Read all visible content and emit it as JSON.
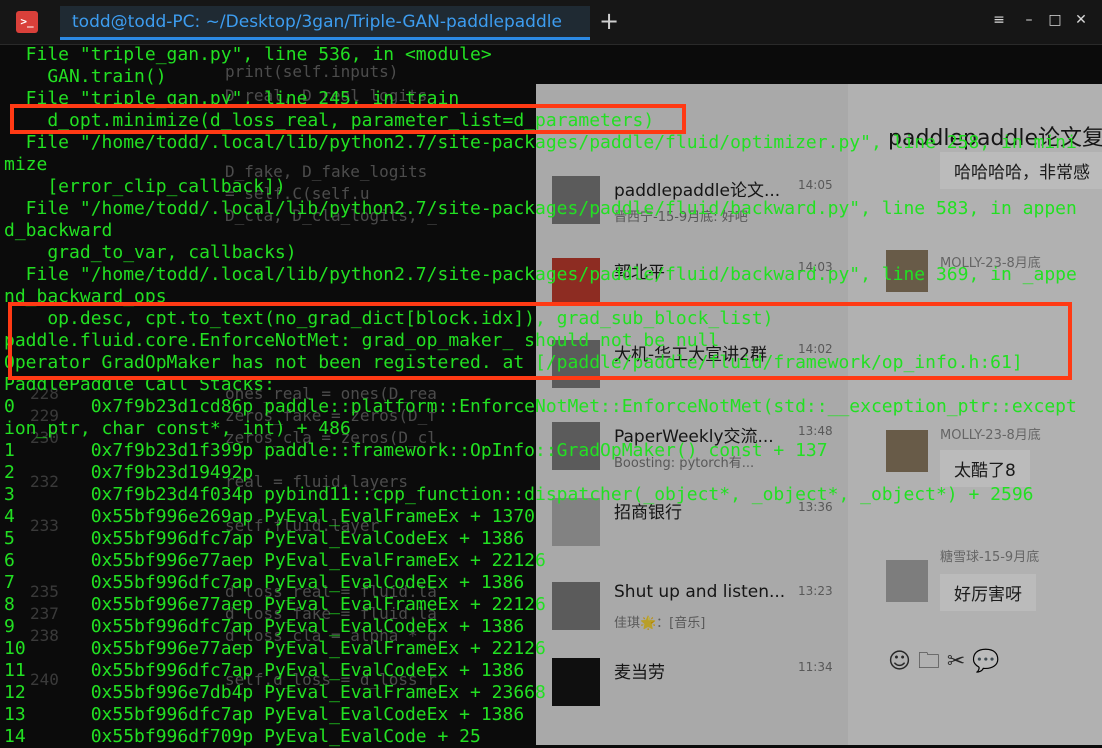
{
  "window": {
    "title": "todd@todd-PC: ~/Desktop/3gan/Triple-GAN-paddlepaddle",
    "new_tab_symbol": "+",
    "controls": [
      "≡",
      "–",
      "□",
      "✕"
    ]
  },
  "colors": {
    "terminal_text": "#22e022",
    "tab_accent": "#2b8ae6",
    "highlight_border": "#ff3a14"
  },
  "editor_ghost": {
    "lines": [
      {
        "num": "",
        "code": "print(self.inputs)"
      },
      {
        "num": "",
        "code": "D_real, D_real_logits"
      },
      {
        "num": "",
        "code": "D_fake, D_fake_logits"
      },
      {
        "num": "",
        "code": "= self.C(self.u"
      },
      {
        "num": "",
        "code": "D_cla, D_cla_logits, _"
      },
      {
        "num": "228",
        "code": "ones_real = ones(D_rea"
      },
      {
        "num": "229",
        "code": "zeros_fake = zeros(D_f"
      },
      {
        "num": "230",
        "code": "zeros_cla = zeros(D_cl"
      },
      {
        "num": "232",
        "code": "real = fluid.layers"
      },
      {
        "num": "233",
        "code": "self.fluid.layer"
      },
      {
        "num": "235",
        "code": "d_loss_real = fluid.la"
      },
      {
        "num": "237",
        "code": "d_loss_fake = fluid.la"
      },
      {
        "num": "238",
        "code": "d_loss_cla = alpha * d"
      },
      {
        "num": "240",
        "code": "self.d_loss = d_loss_r"
      }
    ]
  },
  "chat": {
    "items": [
      {
        "name": "paddlepaddle论文...",
        "time": "14:05",
        "sub": "晋西宁-15-9月底: 好吧"
      },
      {
        "name": "郭北平",
        "time": "14:03",
        "sub": ""
      },
      {
        "name": "大机-华工大宣讲2群",
        "time": "14:02",
        "sub": ""
      },
      {
        "name": "PaperWeekly交流...",
        "time": "13:48",
        "sub": "Boosting: pytorch有..."
      },
      {
        "name": "招商银行",
        "time": "13:36",
        "sub": ""
      },
      {
        "name": "Shut up and listen...",
        "time": "13:23",
        "sub": "佳琪🌟：[音乐]"
      },
      {
        "name": "麦当劳",
        "time": "11:34",
        "sub": ""
      }
    ],
    "conversation": {
      "title": "paddlepaddle论文复",
      "messages": [
        {
          "meta": "",
          "text": "哈哈哈哈，非常感"
        },
        {
          "meta": "MOLLY-23-8月底",
          "text": ""
        },
        {
          "meta": "MOLLY-23-8月底",
          "text": "太酷了8"
        },
        {
          "meta": "糖雪球-15-9月底",
          "text": "好厉害呀"
        }
      ],
      "toolbar": "☺ 🗀 ✂ 💬"
    }
  },
  "terminal": {
    "lines": [
      "  File \"triple_gan.py\", line 536, in <module>",
      "    GAN.train()",
      "  File \"triple_gan.py\", line 245, in train",
      "    d_opt.minimize(d_loss_real, parameter_list=d_parameters)",
      "  File \"/home/todd/.local/lib/python2.7/site-packages/paddle/fluid/optimizer.py\", line 258, in mini",
      "mize",
      "    [error_clip_callback])",
      "  File \"/home/todd/.local/lib/python2.7/site-packages/paddle/fluid/backward.py\", line 583, in appen",
      "d_backward",
      "    grad_to_var, callbacks)",
      "  File \"/home/todd/.local/lib/python2.7/site-packages/paddle/fluid/backward.py\", line 369, in _appe",
      "nd_backward_ops",
      "    op.desc, cpt.to_text(no_grad_dict[block.idx]), grad_sub_block_list)",
      "paddle.fluid.core.EnforceNotMet: grad_op_maker_ should not be null",
      "Operator GradOpMaker has not been registered. at [/paddle/paddle/fluid/framework/op_info.h:61]",
      "PaddlePaddle Call Stacks:",
      "0       0x7f9b23d1cd86p paddle::platform::EnforceNotMet::EnforceNotMet(std::__exception_ptr::except",
      "ion_ptr, char const*, int) + 486",
      "1       0x7f9b23d1f399p paddle::framework::OpInfo::GradOpMaker() const + 137",
      "2       0x7f9b23d19492p",
      "3       0x7f9b23d4f034p pybind11::cpp_function::dispatcher(_object*, _object*, _object*) + 2596",
      "4       0x55bf996e269ap PyEval_EvalFrameEx + 1370",
      "5       0x55bf996dfc7ap PyEval_EvalCodeEx + 1386",
      "6       0x55bf996e77aep PyEval_EvalFrameEx + 22126",
      "7       0x55bf996dfc7ap PyEval_EvalCodeEx + 1386",
      "8       0x55bf996e77aep PyEval_EvalFrameEx + 22126",
      "9       0x55bf996dfc7ap PyEval_EvalCodeEx + 1386",
      "10      0x55bf996e77aep PyEval_EvalFrameEx + 22126",
      "11      0x55bf996dfc7ap PyEval_EvalCodeEx + 1386",
      "12      0x55bf996e7db4p PyEval_EvalFrameEx + 23668",
      "13      0x55bf996dfc7ap PyEval_EvalCodeEx + 1386",
      "14      0x55bf996df709p PyEval_EvalCode + 25"
    ]
  }
}
